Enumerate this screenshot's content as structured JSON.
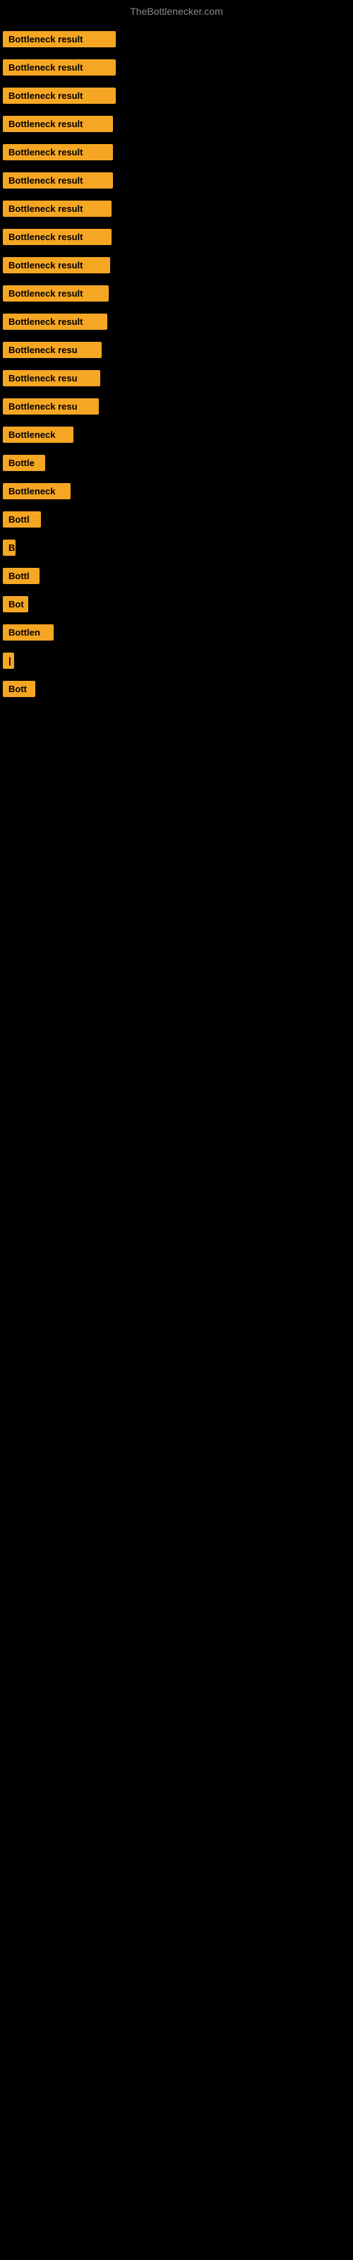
{
  "header": {
    "title": "TheBottlenecker.com"
  },
  "results": [
    {
      "id": 1,
      "label": "Bottleneck result",
      "width": 160
    },
    {
      "id": 2,
      "label": "Bottleneck result",
      "width": 160
    },
    {
      "id": 3,
      "label": "Bottleneck result",
      "width": 160
    },
    {
      "id": 4,
      "label": "Bottleneck result",
      "width": 156
    },
    {
      "id": 5,
      "label": "Bottleneck result",
      "width": 156
    },
    {
      "id": 6,
      "label": "Bottleneck result",
      "width": 156
    },
    {
      "id": 7,
      "label": "Bottleneck result",
      "width": 154
    },
    {
      "id": 8,
      "label": "Bottleneck result",
      "width": 154
    },
    {
      "id": 9,
      "label": "Bottleneck result",
      "width": 152
    },
    {
      "id": 10,
      "label": "Bottleneck result",
      "width": 150
    },
    {
      "id": 11,
      "label": "Bottleneck result",
      "width": 148
    },
    {
      "id": 12,
      "label": "Bottleneck resu",
      "width": 140
    },
    {
      "id": 13,
      "label": "Bottleneck resu",
      "width": 138
    },
    {
      "id": 14,
      "label": "Bottleneck resu",
      "width": 136
    },
    {
      "id": 15,
      "label": "Bottleneck",
      "width": 100
    },
    {
      "id": 16,
      "label": "Bottle",
      "width": 60
    },
    {
      "id": 17,
      "label": "Bottleneck",
      "width": 96
    },
    {
      "id": 18,
      "label": "Bottl",
      "width": 54
    },
    {
      "id": 19,
      "label": "B",
      "width": 18
    },
    {
      "id": 20,
      "label": "Bottl",
      "width": 52
    },
    {
      "id": 21,
      "label": "Bot",
      "width": 36
    },
    {
      "id": 22,
      "label": "Bottlen",
      "width": 72
    },
    {
      "id": 23,
      "label": "|",
      "width": 10
    },
    {
      "id": 24,
      "label": "Bott",
      "width": 46
    }
  ],
  "colors": {
    "badge_bg": "#f5a623",
    "badge_text": "#000000",
    "bg": "#000000",
    "header_text": "#888888"
  }
}
